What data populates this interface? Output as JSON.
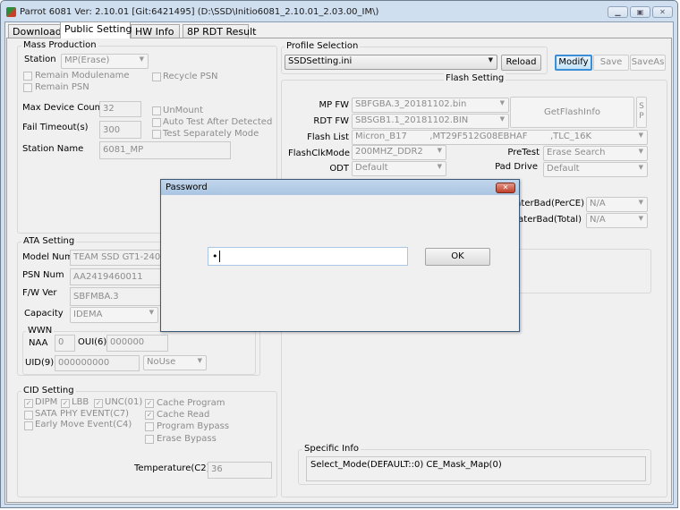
{
  "window": {
    "title": "Parrot 6081 Ver: 2.10.01 [Git:6421495] (D:\\SSD\\Initio6081_2.10.01_2.03.00_IM\\)",
    "controls": [
      "minimize",
      "maximize",
      "close"
    ]
  },
  "tabs": [
    {
      "label": "Download"
    },
    {
      "label": "Public Setting",
      "selected": true
    },
    {
      "label": "HW Info"
    },
    {
      "label": "8P RDT Result"
    }
  ],
  "mass_production": {
    "title": "Mass Production",
    "station_label": "Station",
    "station_value": "MP(Erase)",
    "remain_modulename": "Remain Modulename",
    "remain_psn": "Remain PSN",
    "recycle_psn": "Recycle PSN",
    "max_device_count_label": "Max Device Count",
    "max_device_count": "32",
    "fail_timeout_label": "Fail Timeout(s)",
    "fail_timeout": "300",
    "unmount": "UnMount",
    "auto_test": "Auto Test After Detected",
    "test_separately": "Test Separately Mode",
    "station_name_label": "Station Name",
    "station_name": "6081_MP"
  },
  "ata": {
    "title": "ATA Setting",
    "model_label": "Model Num",
    "model": "TEAM SSD GT1-240GB",
    "psn_label": "PSN Num",
    "psn": "AA2419460011",
    "fw_label": "F/W Ver",
    "fw": "SBFMBA.3",
    "capacity_label": "Capacity",
    "capacity": "IDEMA",
    "wwn_title": "WWN",
    "naa_label": "NAA",
    "naa": "0",
    "oui_label": "OUI(6)",
    "oui": "000000",
    "uid_label": "UID(9)",
    "uid": "000000000",
    "uid_mode": "NoUse"
  },
  "cid": {
    "title": "CID Setting",
    "items": [
      {
        "label": "DIPM",
        "checked": true
      },
      {
        "label": "LBB",
        "checked": true
      },
      {
        "label": "UNC(01)",
        "checked": true
      },
      {
        "label": "Cache Program",
        "checked": true
      },
      {
        "label": "SATA PHY EVENT(C7)",
        "checked": false
      },
      {
        "label": "Cache Read",
        "checked": true
      },
      {
        "label": "Early Move Event(C4)",
        "checked": false
      },
      {
        "label": "Program Bypass",
        "checked": false
      },
      {
        "label": "Erase Bypass",
        "checked": false
      }
    ],
    "temp_label": "Temperature(C2)",
    "temp": "36"
  },
  "profile": {
    "title": "Profile Selection",
    "value": "SSDSetting.ini",
    "reload": "Reload",
    "modify": "Modify",
    "save": "Save",
    "saveas": "SaveAs"
  },
  "flash": {
    "title": "Flash Setting",
    "mpfw_label": "MP FW",
    "mpfw": "SBFGBA.3_20181102.bin",
    "rdtfw_label": "RDT FW",
    "rdtfw": "SBSGB1.1_20181102.BIN",
    "getflashinfo": "GetFlashInfo",
    "sp": "S P",
    "flashlist_label": "Flash List",
    "flashlist": "Micron_B17        ,MT29F512G08EBHAF        ,TLC_16K",
    "clk_label": "FlashClkMode",
    "clk": "200MHZ_DDR2",
    "pretest_label": "PreTest",
    "pretest": "Erase Search",
    "odt_label": "ODT",
    "odt": "Default",
    "pad_label": "Pad Drive",
    "pad": "Default",
    "laterbad_perce_label": "LaterBad(PerCE)",
    "laterbad_perce": "N/A",
    "laterbad_total_label": "LaterBad(Total)",
    "laterbad_total": "N/A",
    "specific_title": "Specific Info",
    "specific": "Select_Mode(DEFAULT::0) CE_Mask_Map(0)"
  },
  "dialog": {
    "title": "Password",
    "value": "•",
    "ok": "OK"
  }
}
